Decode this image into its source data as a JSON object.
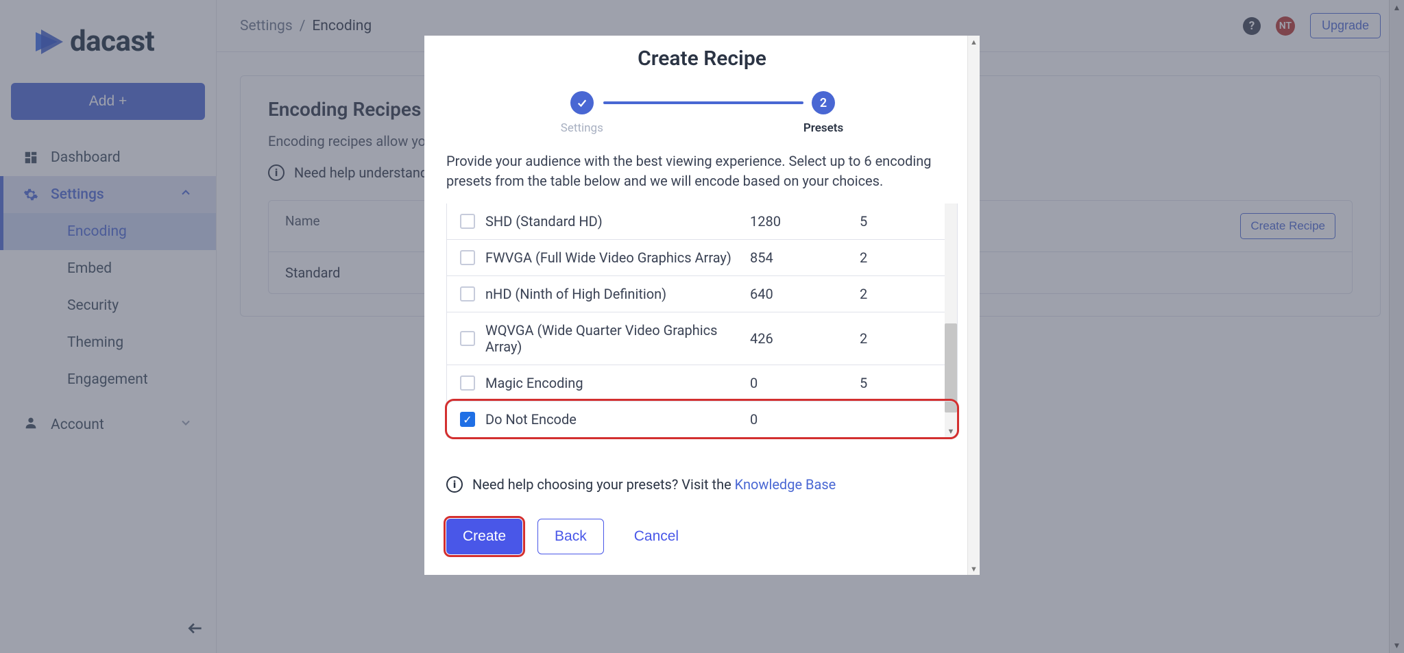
{
  "brand": {
    "name": "dacast"
  },
  "sidebar": {
    "add_label": "Add +",
    "items": [
      {
        "label": "Dashboard"
      },
      {
        "label": "Settings"
      }
    ],
    "settings_children": [
      {
        "label": "Encoding"
      },
      {
        "label": "Embed"
      },
      {
        "label": "Security"
      },
      {
        "label": "Theming"
      },
      {
        "label": "Engagement"
      }
    ],
    "account_label": "Account"
  },
  "topbar": {
    "crumb_root": "Settings",
    "crumb_sep": "/",
    "crumb_leaf": "Encoding",
    "avatar_initials": "NT",
    "upgrade_label": "Upgrade"
  },
  "page": {
    "title": "Encoding Recipes",
    "description": "Encoding recipes allow you t",
    "help_text": "Need help understandi",
    "table_header_name": "Name",
    "create_recipe_label": "Create Recipe",
    "rows": [
      {
        "name": "Standard"
      }
    ]
  },
  "modal": {
    "title": "Create Recipe",
    "step1_label": "Settings",
    "step2_num": "2",
    "step2_label": "Presets",
    "description": "Provide your audience with the best viewing experience. Select up to 6 encoding presets from the table below and we will encode based on your choices.",
    "presets": [
      {
        "name": "SHD (Standard HD)",
        "col1": "1280",
        "col2": "5",
        "checked": false
      },
      {
        "name": "FWVGA (Full Wide Video Graphics Array)",
        "col1": "854",
        "col2": "2",
        "checked": false
      },
      {
        "name": "nHD (Ninth of High Definition)",
        "col1": "640",
        "col2": "2",
        "checked": false
      },
      {
        "name": "WQVGA (Wide Quarter Video Graphics Array)",
        "col1": "426",
        "col2": "2",
        "checked": false
      },
      {
        "name": "Magic Encoding",
        "col1": "0",
        "col2": "5",
        "checked": false
      },
      {
        "name": "Do Not Encode",
        "col1": "0",
        "col2": "",
        "checked": true
      }
    ],
    "help_text": "Need help choosing your presets? Visit the ",
    "help_link": "Knowledge Base",
    "create_label": "Create",
    "back_label": "Back",
    "cancel_label": "Cancel"
  }
}
